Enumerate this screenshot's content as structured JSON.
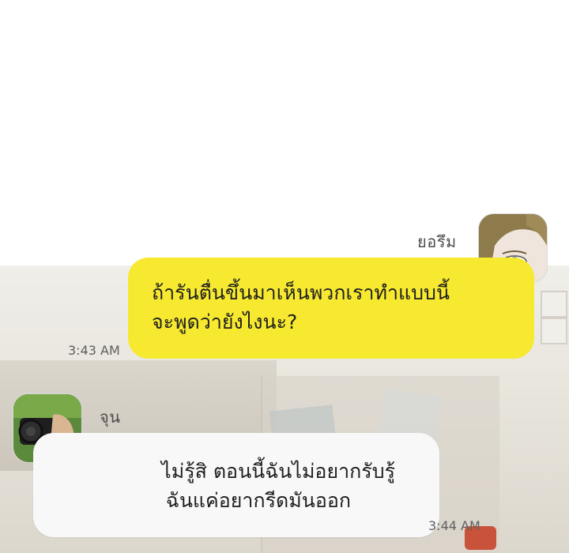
{
  "messages": [
    {
      "sender": "ยอรึม",
      "side": "right",
      "bubble_color": "#f7e92f",
      "lines": [
        "ถ้ารันตื่นขึ้นมาเห็นพวกเราทำแบบนี้",
        "จะพูดว่ายังไงนะ?"
      ],
      "time": "3:43 AM"
    },
    {
      "sender": "จุน",
      "side": "left",
      "bubble_color": "#f8f8f8",
      "lines": [
        "ไม่รู้สิ ตอนนี้ฉันไม่อยากรับรู้",
        "ฉันแค่อยากรีดมันออก"
      ],
      "time": "3:44 AM"
    }
  ]
}
